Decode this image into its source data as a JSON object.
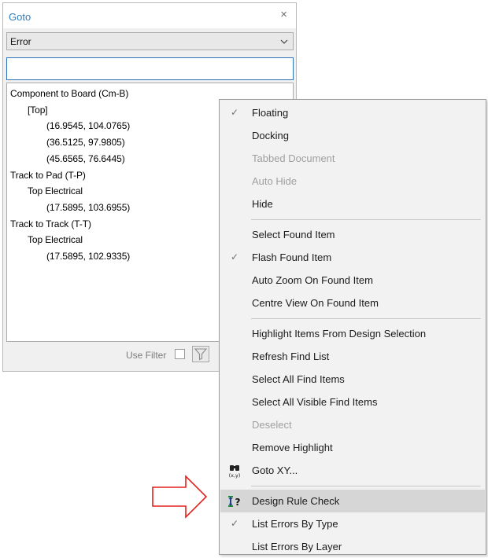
{
  "panel": {
    "title": "Goto",
    "close_glyph": "×",
    "filter_selected": "Error",
    "search_value": "",
    "tree": [
      {
        "text": "Component to Board  (Cm-B)",
        "level": 0
      },
      {
        "text": "[Top]",
        "level": 1
      },
      {
        "text": "(16.9545,  104.0765)",
        "level": 2
      },
      {
        "text": "(36.5125,  97.9805)",
        "level": 2
      },
      {
        "text": "(45.6565,  76.6445)",
        "level": 2
      },
      {
        "text": "Track to Pad  (T-P)",
        "level": 0
      },
      {
        "text": "Top Electrical",
        "level": 1
      },
      {
        "text": "(17.5895,  103.6955)",
        "level": 2
      },
      {
        "text": "Track to Track  (T-T)",
        "level": 0
      },
      {
        "text": "Top Electrical",
        "level": 1
      },
      {
        "text": "(17.5895,  102.9335)",
        "level": 2
      }
    ],
    "use_filter_label": "Use Filter",
    "use_filter_checked": false,
    "filter_icon": "funnel-icon"
  },
  "menu": {
    "items": [
      {
        "label": "Floating",
        "checked": true,
        "disabled": false
      },
      {
        "label": "Docking",
        "checked": false,
        "disabled": false
      },
      {
        "label": "Tabbed Document",
        "checked": false,
        "disabled": true
      },
      {
        "label": "Auto Hide",
        "checked": false,
        "disabled": true
      },
      {
        "label": "Hide",
        "checked": false,
        "disabled": false
      },
      {
        "separator": true
      },
      {
        "label": "Select Found Item",
        "checked": false,
        "disabled": false
      },
      {
        "label": "Flash Found Item",
        "checked": true,
        "disabled": false
      },
      {
        "label": "Auto Zoom On Found Item",
        "checked": false,
        "disabled": false
      },
      {
        "label": "Centre View On Found Item",
        "checked": false,
        "disabled": false
      },
      {
        "separator": true
      },
      {
        "label": "Highlight Items From Design Selection",
        "checked": false,
        "disabled": false
      },
      {
        "label": "Refresh Find List",
        "checked": false,
        "disabled": false
      },
      {
        "label": "Select All Find Items",
        "checked": false,
        "disabled": false
      },
      {
        "label": "Select All Visible Find Items",
        "checked": false,
        "disabled": false
      },
      {
        "label": "Deselect",
        "checked": false,
        "disabled": true
      },
      {
        "label": "Remove Highlight",
        "checked": false,
        "disabled": false
      },
      {
        "label": "Goto XY...",
        "checked": false,
        "disabled": false,
        "icon": "binoculars-xy-icon"
      },
      {
        "separator": true
      },
      {
        "label": "Design Rule Check",
        "checked": false,
        "disabled": false,
        "icon": "design-rule-check-icon",
        "highlighted": true
      },
      {
        "label": "List Errors By Type",
        "checked": true,
        "disabled": false
      },
      {
        "label": "List Errors By Layer",
        "checked": false,
        "disabled": false
      }
    ],
    "check_glyph": "✓"
  },
  "colors": {
    "title_blue": "#2f7fc0",
    "highlight": "#d6d6d6",
    "arrow_red": "#e0201b",
    "disabled_text": "#a0a0a0"
  }
}
